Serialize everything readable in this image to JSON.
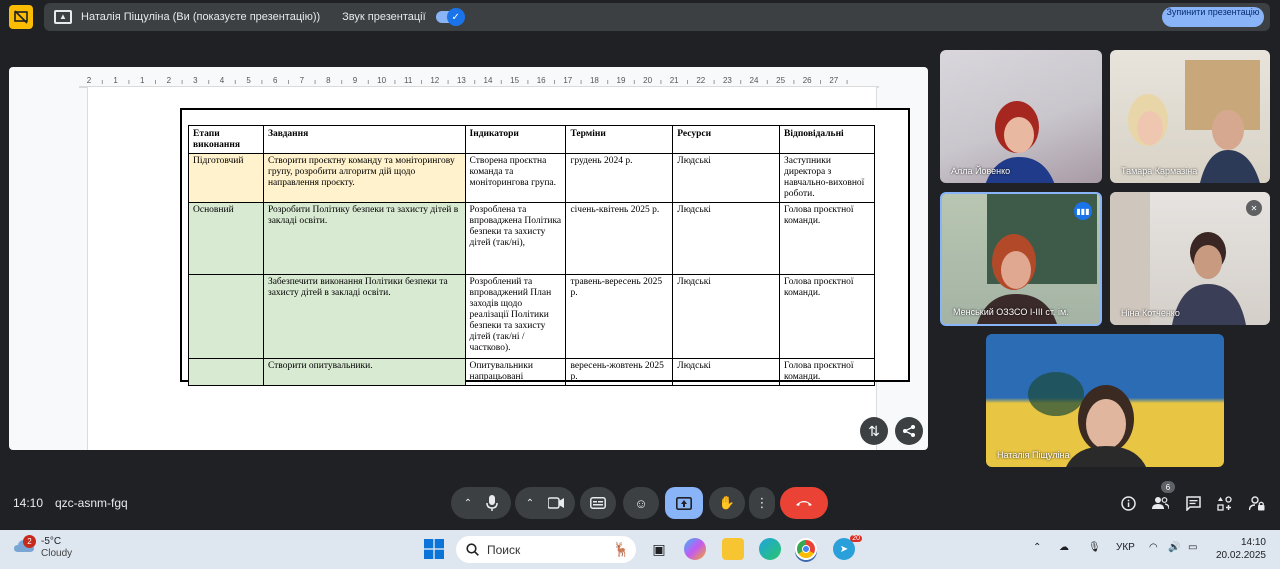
{
  "top_bar": {
    "presenting_title": "Наталія Піщуліна (Ви (показуєте презентацію))",
    "sound_label": "Звук презентації",
    "sound_enabled": true,
    "stop_button": "Зупинити презентацію"
  },
  "document": {
    "ruler_numbers": [
      "2",
      "1",
      "1",
      "2",
      "3",
      "4",
      "5",
      "6",
      "7",
      "8",
      "9",
      "10",
      "11",
      "12",
      "13",
      "14",
      "15",
      "16",
      "17",
      "18",
      "19",
      "20",
      "21",
      "22",
      "23",
      "24",
      "25",
      "26",
      "27"
    ],
    "table": {
      "headers": [
        "Етапи виконання",
        "Завдання",
        "Індикатори",
        "Терміни",
        "Ресурси",
        "Відповідальні"
      ],
      "rows": [
        {
          "stage": "Підготовчий",
          "task": "Створити проєктну команду та моніторингову групу, розробити алгоритм дій щодо направлення проєкту.",
          "indicator": "Створена проєктна команда та моніторингова група.",
          "term": "грудень 2024 р.",
          "resource": "Людські",
          "responsible": "Заступники директора з навчально-виховної роботи."
        },
        {
          "stage": "Основний",
          "task": "Розробити Політику безпеки та захисту дітей в закладі освіти.",
          "indicator": "Розроблена та впроваджена Політика безпеки та захисту дітей (так/ні),",
          "term": "січень-квітень 2025 р.",
          "resource": "Людські",
          "responsible": "Голова проєктної команди."
        },
        {
          "stage": "",
          "task": "Забезпечити виконання Політики безпеки та захисту дітей в закладі освіти.",
          "indicator": "Розроблений та впроваджений План заходів щодо реалізації Політики безпеки та захисту дітей (так/ні /частково).",
          "term": "травень-вересень 2025 р.",
          "resource": "Людські",
          "responsible": "Голова проєктної команди."
        },
        {
          "stage": "",
          "task": "Створити опитувальники.",
          "indicator": "Опитувальники напрацьовані",
          "term": "вересень-жовтень 2025 р.",
          "resource": "Людські",
          "responsible": "Голова проєктної команди."
        }
      ]
    }
  },
  "participants": [
    {
      "name": "Алла Йовенко",
      "muted": false
    },
    {
      "name": "Тамара Кармазіна",
      "muted": false
    },
    {
      "name": "Менський ОЗЗСО І-ІІІ ст. ім.",
      "muted": false,
      "speaking": true
    },
    {
      "name": "Ніна Котченко",
      "muted": true
    },
    {
      "name": "Наталія Піщуліна",
      "muted": false
    }
  ],
  "bottom_bar": {
    "time": "14:10",
    "meeting_code": "qzc-asnm-fgq",
    "people_count": "6"
  },
  "taskbar": {
    "weather_temp": "-5°C",
    "weather_desc": "Cloudy",
    "weather_badge": "2",
    "search_placeholder": "Поиск",
    "telegram_badge": "20",
    "language": "УКР",
    "clock_time": "14:10",
    "clock_date": "20.02.2025"
  },
  "colors": {
    "accent": "#8ab4f8",
    "end_call": "#ea4335",
    "stage_prep": "#fff2cc",
    "stage_main": "#d9ead3"
  }
}
